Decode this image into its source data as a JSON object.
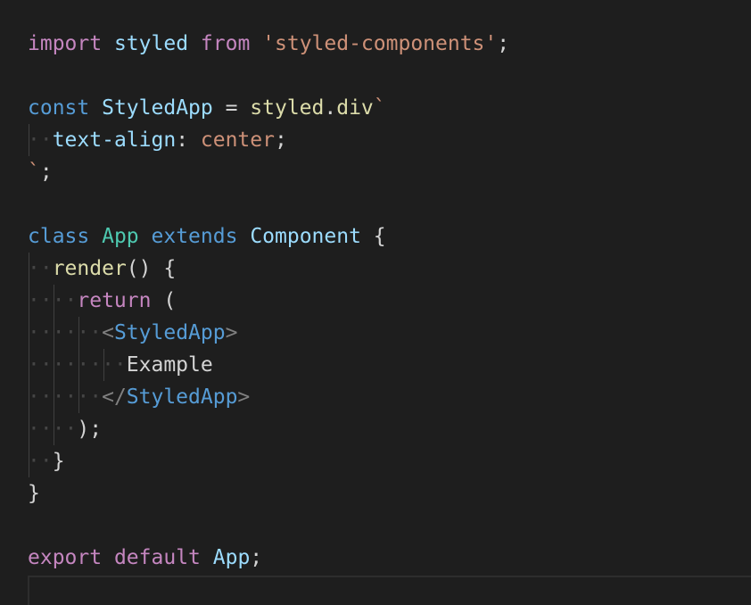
{
  "colors": {
    "background": "#1e1e1e",
    "default": "#d4d4d4",
    "keyword": "#569cd6",
    "control": "#c586c0",
    "variable": "#9cdcfe",
    "type": "#4ec9b0",
    "function": "#dcdcaa",
    "string": "#ce9178",
    "tag": "#569cd6",
    "tag_bracket": "#808080",
    "whitespace": "#464646",
    "indent_guide": "#404040"
  },
  "editor": {
    "language": "javascript (jsx)",
    "whitespace_marker": "·",
    "lines": [
      [
        {
          "t": "import",
          "c": "control"
        },
        {
          "t": " "
        },
        {
          "t": "styled",
          "c": "variable"
        },
        {
          "t": " "
        },
        {
          "t": "from",
          "c": "control"
        },
        {
          "t": " "
        },
        {
          "t": "'styled-components'",
          "c": "string"
        },
        {
          "t": ";"
        }
      ],
      [],
      [
        {
          "t": "const",
          "c": "keyword"
        },
        {
          "t": " "
        },
        {
          "t": "StyledApp",
          "c": "variable"
        },
        {
          "t": " = "
        },
        {
          "t": "styled",
          "c": "function"
        },
        {
          "t": "."
        },
        {
          "t": "div",
          "c": "function"
        },
        {
          "t": "`",
          "c": "string"
        }
      ],
      [
        {
          "t": "  ",
          "c": "ws"
        },
        {
          "t": "text-align",
          "c": "variable"
        },
        {
          "t": ": "
        },
        {
          "t": "center",
          "c": "string"
        },
        {
          "t": ";"
        }
      ],
      [
        {
          "t": "`",
          "c": "string"
        },
        {
          "t": ";"
        }
      ],
      [],
      [
        {
          "t": "class",
          "c": "keyword"
        },
        {
          "t": " "
        },
        {
          "t": "App",
          "c": "type"
        },
        {
          "t": " "
        },
        {
          "t": "extends",
          "c": "keyword"
        },
        {
          "t": " "
        },
        {
          "t": "Component",
          "c": "variable"
        },
        {
          "t": " {"
        }
      ],
      [
        {
          "t": "  ",
          "c": "ws"
        },
        {
          "t": "render",
          "c": "function"
        },
        {
          "t": "() {"
        }
      ],
      [
        {
          "t": "    ",
          "c": "ws"
        },
        {
          "t": "return",
          "c": "control"
        },
        {
          "t": " ("
        }
      ],
      [
        {
          "t": "      ",
          "c": "ws"
        },
        {
          "t": "<",
          "c": "tag_bracket"
        },
        {
          "t": "StyledApp",
          "c": "tag"
        },
        {
          "t": ">",
          "c": "tag_bracket"
        }
      ],
      [
        {
          "t": "        ",
          "c": "ws"
        },
        {
          "t": "Example"
        }
      ],
      [
        {
          "t": "      ",
          "c": "ws"
        },
        {
          "t": "</",
          "c": "tag_bracket"
        },
        {
          "t": "StyledApp",
          "c": "tag"
        },
        {
          "t": ">",
          "c": "tag_bracket"
        }
      ],
      [
        {
          "t": "    ",
          "c": "ws"
        },
        {
          "t": ");"
        }
      ],
      [
        {
          "t": "  ",
          "c": "ws"
        },
        {
          "t": "}"
        }
      ],
      [
        {
          "t": "}"
        }
      ],
      [],
      [
        {
          "t": "export",
          "c": "control"
        },
        {
          "t": " "
        },
        {
          "t": "default",
          "c": "control"
        },
        {
          "t": " "
        },
        {
          "t": "App",
          "c": "variable"
        },
        {
          "t": ";"
        }
      ]
    ]
  }
}
